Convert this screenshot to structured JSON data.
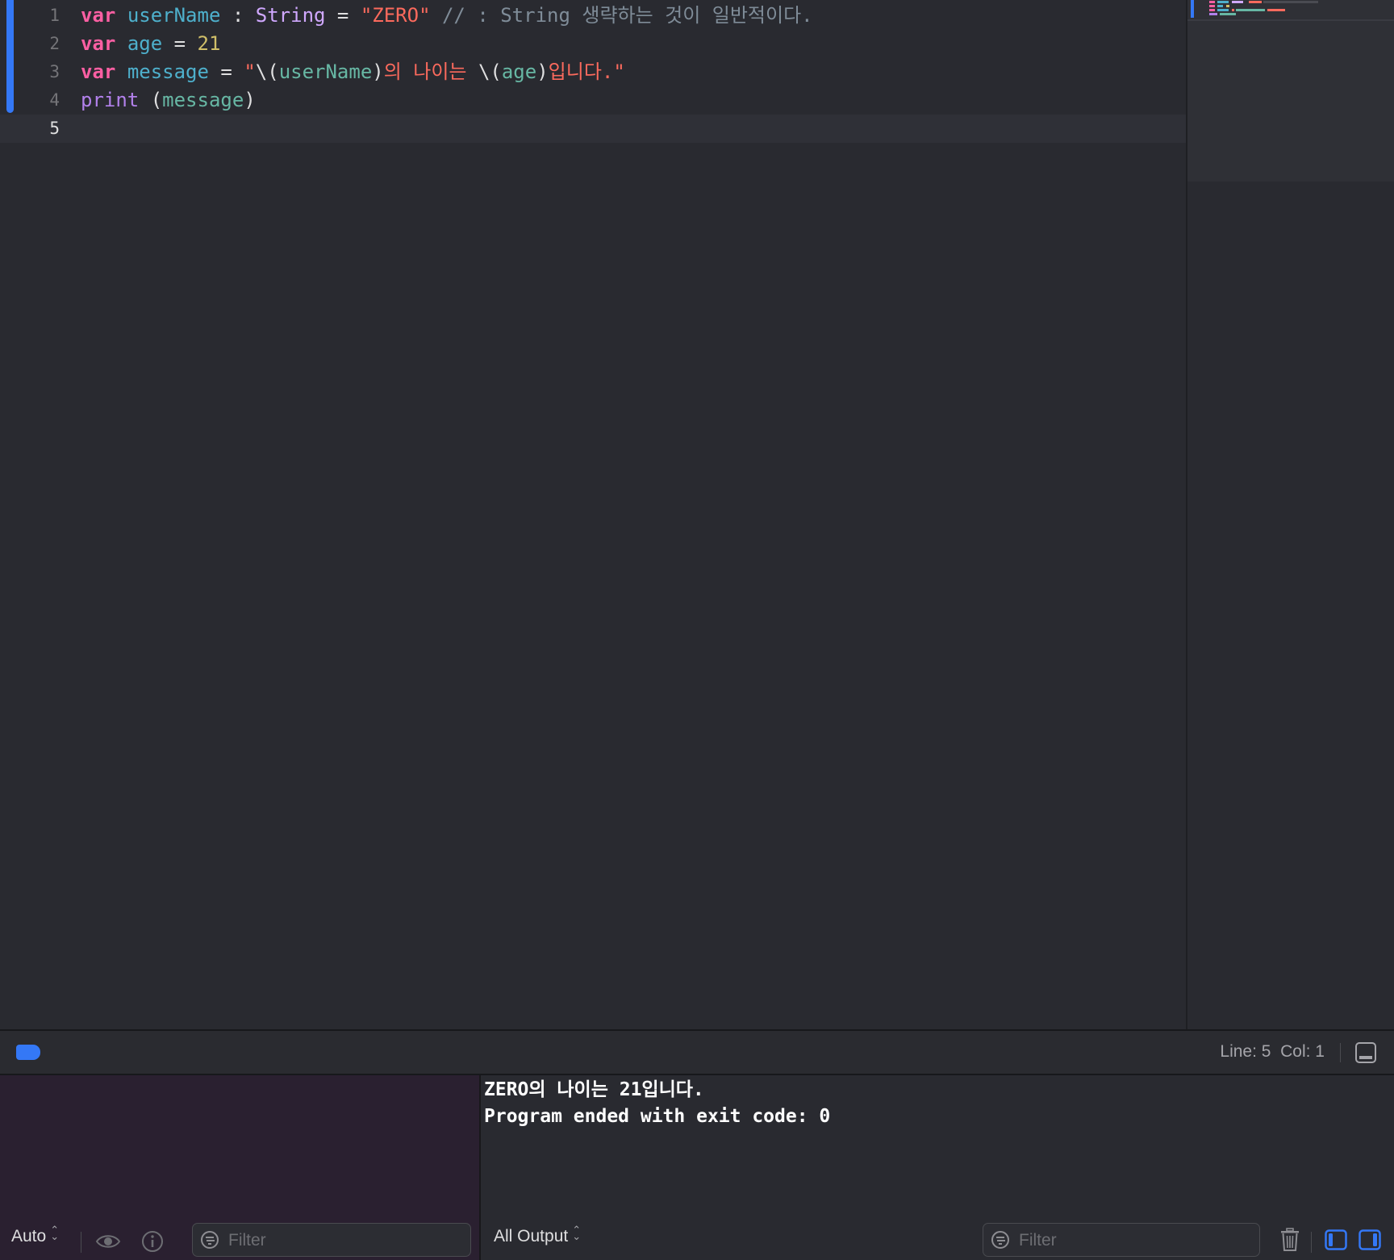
{
  "editor": {
    "lines": [
      {
        "number": "1",
        "tokens": [
          {
            "t": "var",
            "c": "kw"
          },
          {
            "t": " ",
            "c": "plain"
          },
          {
            "t": "userName",
            "c": "decl"
          },
          {
            "t": " : ",
            "c": "plain"
          },
          {
            "t": "String",
            "c": "type"
          },
          {
            "t": " = ",
            "c": "plain"
          },
          {
            "t": "\"ZERO\"",
            "c": "str"
          },
          {
            "t": " // : String 생략하는 것이 일반적이다.",
            "c": "cmt"
          }
        ]
      },
      {
        "number": "2",
        "tokens": [
          {
            "t": "var",
            "c": "kw"
          },
          {
            "t": " ",
            "c": "plain"
          },
          {
            "t": "age",
            "c": "decl"
          },
          {
            "t": " = ",
            "c": "plain"
          },
          {
            "t": "21",
            "c": "num"
          }
        ]
      },
      {
        "number": "3",
        "tokens": [
          {
            "t": "var",
            "c": "kw"
          },
          {
            "t": " ",
            "c": "plain"
          },
          {
            "t": "message",
            "c": "decl"
          },
          {
            "t": " = ",
            "c": "plain"
          },
          {
            "t": "\"",
            "c": "str"
          },
          {
            "t": "\\(",
            "c": "plain"
          },
          {
            "t": "userName",
            "c": "id"
          },
          {
            "t": ")",
            "c": "plain"
          },
          {
            "t": "의 나이는 ",
            "c": "str"
          },
          {
            "t": "\\(",
            "c": "plain"
          },
          {
            "t": "age",
            "c": "id"
          },
          {
            "t": ")",
            "c": "plain"
          },
          {
            "t": "입니다.\"",
            "c": "str"
          }
        ]
      },
      {
        "number": "4",
        "tokens": [
          {
            "t": "print",
            "c": "fn"
          },
          {
            "t": " (",
            "c": "plain"
          },
          {
            "t": "message",
            "c": "id"
          },
          {
            "t": ")",
            "c": "plain"
          }
        ]
      },
      {
        "number": "5",
        "tokens": []
      }
    ],
    "current_line": 5
  },
  "statusbar": {
    "cursor_position": "Line: 5  Col: 1"
  },
  "debug": {
    "variables_toolbar": {
      "scope_select": "Auto",
      "filter_placeholder": "Filter"
    },
    "console": {
      "output": "ZERO의 나이는 21입니다.\nProgram ended with exit code: 0",
      "output_select": "All Output",
      "filter_placeholder": "Filter"
    }
  },
  "colors": {
    "accent": "#3478f6",
    "keyword": "#fc5fa3",
    "string": "#fc6a5d",
    "number": "#d0bf69",
    "type": "#d0a8ff",
    "comment": "#7f8c98"
  },
  "icons": {
    "run_badge": "run-status-icon",
    "console_toggle": "hide-console-icon",
    "eye": "eye-icon",
    "info": "info-icon",
    "filter": "filter-icon",
    "trash": "trash-icon",
    "left_panel": "left-panel-icon",
    "right_panel": "right-panel-icon"
  }
}
